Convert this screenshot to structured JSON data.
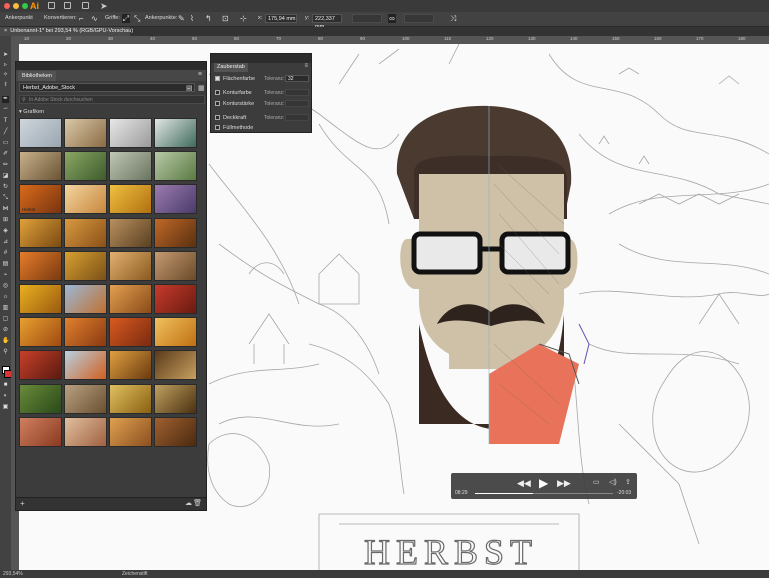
{
  "window": {
    "app_logo": "Ai",
    "traffic_lights": [
      "#fc605b",
      "#fdbc40",
      "#34c749"
    ]
  },
  "control_bar": {
    "anchor_label": "Ankerpunkt",
    "convert_label": "Konvertieren:",
    "handles_label": "Griffe:",
    "anchors_label": "Ankerpunkte:",
    "x_label": "x:",
    "x_value": "175,94 mm",
    "y_label": "y:",
    "y_value": "222,337 mm"
  },
  "document": {
    "tab_title": "Unbenannt-1* bei 293,54 % (RGB/GPU-Vorschau)"
  },
  "ruler_ticks": [
    "10",
    "20",
    "30",
    "40",
    "50",
    "60",
    "70",
    "80",
    "90",
    "100",
    "110",
    "120",
    "130",
    "140",
    "150",
    "160",
    "170",
    "180"
  ],
  "libraries": {
    "tab_title": "Bibliotheken",
    "selected_library": "Herbst_Adobe_Stock",
    "search_placeholder": "In Adobe Stock durchsuchen",
    "section_title": "Grafiken",
    "hover_label": "Herbst"
  },
  "magic_wand": {
    "title": "Zauberstab",
    "rows": [
      {
        "label": "Flächenfarbe",
        "checked": true,
        "tol_label": "Toleranz:",
        "tol_value": "32"
      },
      {
        "label": "Konturfarbe",
        "checked": false,
        "tol_label": "Toleranz:",
        "tol_value": ""
      },
      {
        "label": "Konturstärke",
        "checked": false,
        "tol_label": "Toleranz:",
        "tol_value": ""
      },
      {
        "label": "Deckkraft",
        "checked": false,
        "tol_label": "Toleranz:",
        "tol_value": ""
      },
      {
        "label": "Füllmethode",
        "checked": false,
        "tol_label": "",
        "tol_value": ""
      }
    ]
  },
  "video": {
    "elapsed": "08:29",
    "remaining": "-20:03",
    "progress": 0.42
  },
  "status": {
    "zoom": "293,54%",
    "tool": "Zeichenstift"
  },
  "artwork": {
    "lettering": "HERBST"
  },
  "colors": {
    "hair": "#4a3a30",
    "skin": "#cfc1a8",
    "beard": "#3a2a22",
    "scarf": "#e8735a",
    "ui_dark": "#3c3c3c"
  }
}
